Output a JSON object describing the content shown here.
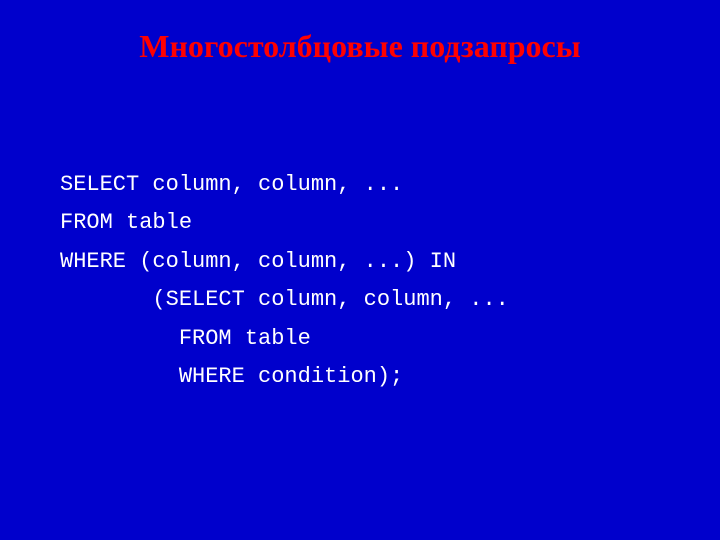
{
  "title": "Многостолбцовые подзапросы",
  "code": {
    "line1": "SELECT column, column, ...",
    "line2": "FROM table",
    "line3": "WHERE (column, column, ...) IN",
    "line4": "       (SELECT column, column, ...",
    "line5": "         FROM table",
    "line6": "         WHERE condition);"
  }
}
